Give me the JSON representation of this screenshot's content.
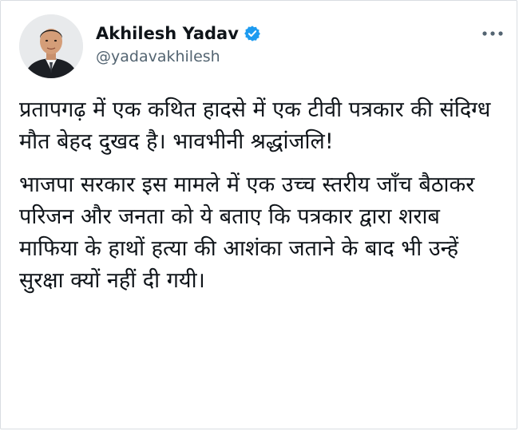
{
  "author": {
    "display_name": "Akhilesh Yadav",
    "handle": "@yadavakhilesh",
    "verified_icon": "verified-badge-icon",
    "avatar_icon": "profile-photo"
  },
  "menu": {
    "more_icon": "more-horizontal-icon"
  },
  "tweet": {
    "paragraphs": [
      "प्रतापगढ़ में एक कथित हादसे में एक टीवी पत्रकार की संदिग्ध मौत बेहद दुखद है। भावभीनी श्रद्धांजलि!",
      "भाजपा सरकार इस मामले में एक उच्च स्तरीय जाँच बैठाकर परिजन और जनता को ये बताए कि पत्रकार द्वारा शराब माफिया के हाथों हत्या की आशंका जताने के बाद भी उन्हें सुरक्षा क्यों नहीं दी गयी।"
    ]
  },
  "colors": {
    "text": "#0f1419",
    "secondary": "#536471",
    "verified": "#1d9bf0"
  }
}
